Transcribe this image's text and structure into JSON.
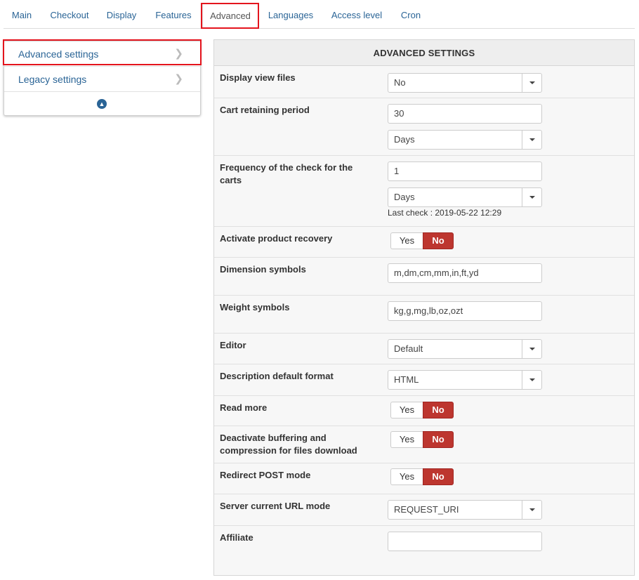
{
  "tabs": [
    "Main",
    "Checkout",
    "Display",
    "Features",
    "Advanced",
    "Languages",
    "Access level",
    "Cron"
  ],
  "sidebar": {
    "items": [
      "Advanced settings",
      "Legacy settings"
    ]
  },
  "panel": {
    "title": "ADVANCED SETTINGS",
    "display_view_files": {
      "label": "Display view files",
      "value": "No"
    },
    "cart_retaining_period": {
      "label": "Cart retaining period",
      "value": "30",
      "unit": "Days"
    },
    "frequency_check": {
      "label": "Frequency of the check for the carts",
      "value": "1",
      "unit": "Days",
      "last_check": "Last check : 2019-05-22 12:29"
    },
    "product_recovery": {
      "label": "Activate product recovery",
      "yes": "Yes",
      "no": "No"
    },
    "dimension_symbols": {
      "label": "Dimension symbols",
      "value": "m,dm,cm,mm,in,ft,yd"
    },
    "weight_symbols": {
      "label": "Weight symbols",
      "value": "kg,g,mg,lb,oz,ozt"
    },
    "editor": {
      "label": "Editor",
      "value": "Default"
    },
    "description_format": {
      "label": "Description default format",
      "value": "HTML"
    },
    "read_more": {
      "label": "Read more",
      "yes": "Yes",
      "no": "No"
    },
    "deactivate_buffering": {
      "label": "Deactivate buffering and compression for files download",
      "yes": "Yes",
      "no": "No"
    },
    "redirect_post": {
      "label": "Redirect POST mode",
      "yes": "Yes",
      "no": "No"
    },
    "server_url_mode": {
      "label": "Server current URL mode",
      "value": "REQUEST_URI"
    },
    "affiliate": {
      "label": "Affiliate",
      "value": ""
    }
  },
  "colors": {
    "link": "#2a6496",
    "toggle_no": "#bd362f",
    "highlight": "#e4141d"
  }
}
